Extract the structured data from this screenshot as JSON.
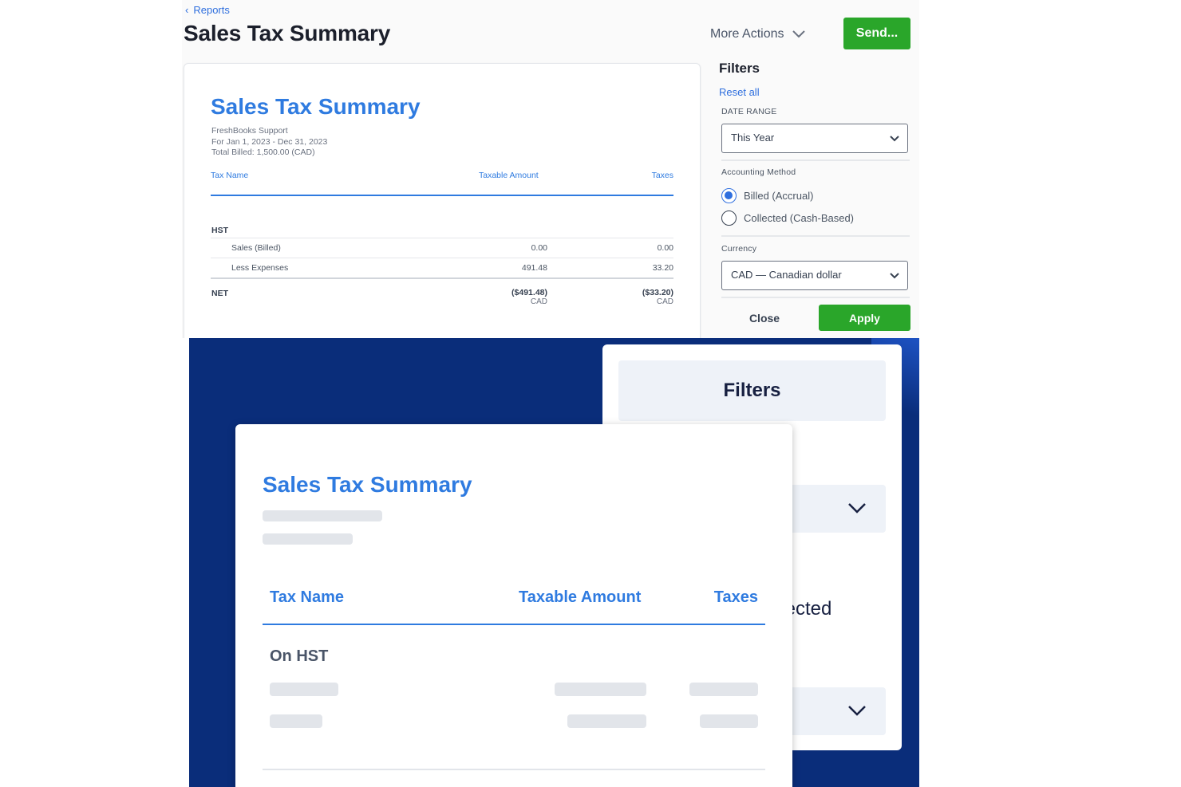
{
  "top": {
    "breadcrumb": "Reports",
    "page_title": "Sales Tax Summary",
    "more_actions": "More Actions",
    "send_button": "Send...",
    "report": {
      "title": "Sales Tax Summary",
      "meta": [
        "FreshBooks Support",
        "For Jan 1, 2023 - Dec 31, 2023",
        "Total Billed: 1,500.00 (CAD)"
      ],
      "columns": {
        "tax_name": "Tax Name",
        "taxable_amount": "Taxable Amount",
        "taxes": "Taxes"
      },
      "section": "HST",
      "rows": [
        {
          "name": "Sales (Billed)",
          "taxable": "0.00",
          "taxes": "0.00"
        },
        {
          "name": "Less Expenses",
          "taxable": "491.48",
          "taxes": "33.20"
        }
      ],
      "net": {
        "label": "NET",
        "taxable": "($491.48)",
        "taxes": "($33.20)",
        "currency": "CAD"
      }
    },
    "filters": {
      "title": "Filters",
      "reset_all": "Reset all",
      "date_range_label": "DATE RANGE",
      "date_range_value": "This Year",
      "accounting_method_label": "Accounting Method",
      "method_options": [
        {
          "label": "Billed (Accrual)",
          "selected": true
        },
        {
          "label": "Collected (Cash-Based)",
          "selected": false
        }
      ],
      "currency_label": "Currency",
      "currency_value": "CAD — Canadian dollar",
      "close_button": "Close",
      "apply_button": "Apply"
    }
  },
  "bottom": {
    "filters_title": "Filters",
    "partial_text": "llected",
    "report": {
      "title": "Sales Tax Summary",
      "columns": {
        "tax_name": "Tax Name",
        "taxable_amount": "Taxable Amount",
        "taxes": "Taxes"
      },
      "section": "On HST"
    }
  },
  "colors": {
    "accent_blue": "#2f7be0",
    "link_blue": "#2f6fde",
    "green": "#2aa62a",
    "navy": "#0a2d7a"
  }
}
